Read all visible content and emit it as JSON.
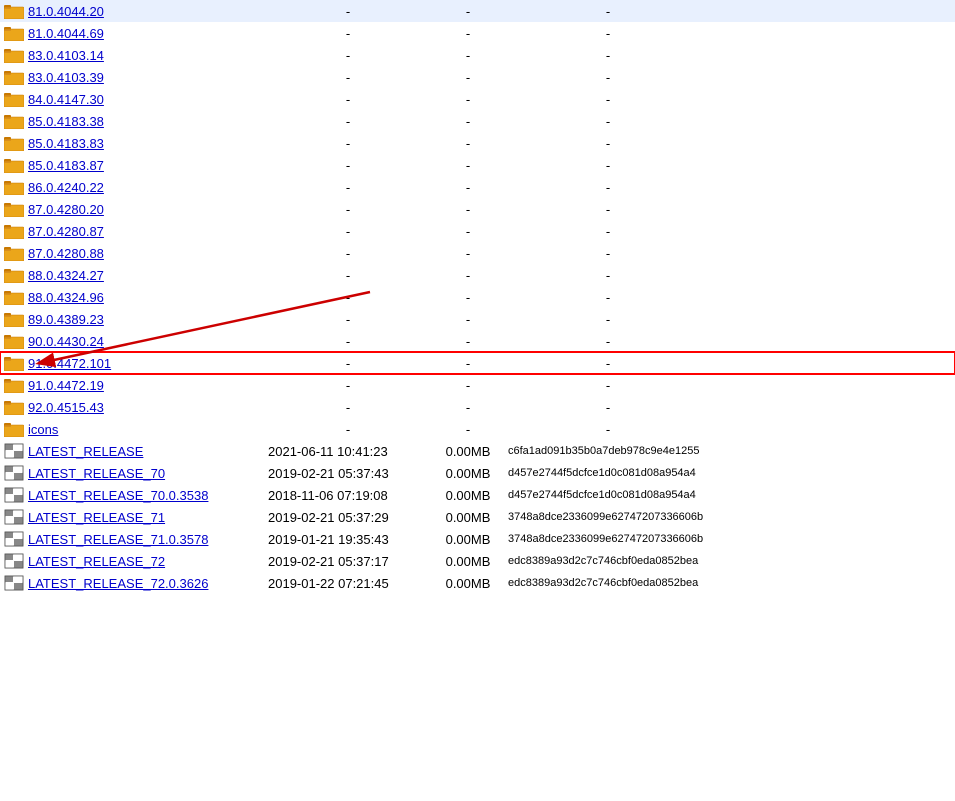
{
  "rows": [
    {
      "type": "folder",
      "name": "81.0.4044.20",
      "date": "",
      "size": "",
      "hash": "",
      "dashes": [
        "-",
        "-",
        "-"
      ]
    },
    {
      "type": "folder",
      "name": "81.0.4044.69",
      "date": "",
      "size": "",
      "hash": "",
      "dashes": [
        "-",
        "-",
        "-"
      ]
    },
    {
      "type": "folder",
      "name": "83.0.4103.14",
      "date": "",
      "size": "",
      "hash": "",
      "dashes": [
        "-",
        "-",
        "-"
      ]
    },
    {
      "type": "folder",
      "name": "83.0.4103.39",
      "date": "",
      "size": "",
      "hash": "",
      "dashes": [
        "-",
        "-",
        "-"
      ]
    },
    {
      "type": "folder",
      "name": "84.0.4147.30",
      "date": "",
      "size": "",
      "hash": "",
      "dashes": [
        "-",
        "-",
        "-"
      ]
    },
    {
      "type": "folder",
      "name": "85.0.4183.38",
      "date": "",
      "size": "",
      "hash": "",
      "dashes": [
        "-",
        "-",
        "-"
      ]
    },
    {
      "type": "folder",
      "name": "85.0.4183.83",
      "date": "",
      "size": "",
      "hash": "",
      "dashes": [
        "-",
        "-",
        "-"
      ]
    },
    {
      "type": "folder",
      "name": "85.0.4183.87",
      "date": "",
      "size": "",
      "hash": "",
      "dashes": [
        "-",
        "-",
        "-"
      ]
    },
    {
      "type": "folder",
      "name": "86.0.4240.22",
      "date": "",
      "size": "",
      "hash": "",
      "dashes": [
        "-",
        "-",
        "-"
      ]
    },
    {
      "type": "folder",
      "name": "87.0.4280.20",
      "date": "",
      "size": "",
      "hash": "",
      "dashes": [
        "-",
        "-",
        "-"
      ]
    },
    {
      "type": "folder",
      "name": "87.0.4280.87",
      "date": "",
      "size": "",
      "hash": "",
      "dashes": [
        "-",
        "-",
        "-"
      ]
    },
    {
      "type": "folder",
      "name": "87.0.4280.88",
      "date": "",
      "size": "",
      "hash": "",
      "dashes": [
        "-",
        "-",
        "-"
      ]
    },
    {
      "type": "folder",
      "name": "88.0.4324.27",
      "date": "",
      "size": "",
      "hash": "",
      "dashes": [
        "-",
        "-",
        "-"
      ]
    },
    {
      "type": "folder",
      "name": "88.0.4324.96",
      "date": "",
      "size": "",
      "hash": "",
      "dashes": [
        "-",
        "-",
        "-"
      ]
    },
    {
      "type": "folder",
      "name": "89.0.4389.23",
      "date": "",
      "size": "",
      "hash": "",
      "dashes": [
        "-",
        "-",
        "-"
      ]
    },
    {
      "type": "folder",
      "name": "90.0.4430.24",
      "date": "",
      "size": "",
      "hash": "",
      "dashes": [
        "-",
        "-",
        "-"
      ]
    },
    {
      "type": "folder",
      "name": "91.0.4472.101",
      "date": "",
      "size": "",
      "hash": "",
      "dashes": [
        "-",
        "-",
        "-"
      ],
      "highlighted": true
    },
    {
      "type": "folder",
      "name": "91.0.4472.19",
      "date": "",
      "size": "",
      "hash": "",
      "dashes": [
        "-",
        "-",
        "-"
      ]
    },
    {
      "type": "folder",
      "name": "92.0.4515.43",
      "date": "",
      "size": "",
      "hash": "",
      "dashes": [
        "-",
        "-",
        "-"
      ]
    },
    {
      "type": "folder",
      "name": "icons",
      "date": "",
      "size": "",
      "hash": "",
      "dashes": [
        "-",
        "-",
        "-"
      ]
    },
    {
      "type": "file",
      "name": "LATEST_RELEASE",
      "date": "2021-06-11 10:41:23",
      "size": "0.00MB",
      "hash": "c6fa1ad091b35b0a7deb978c9e4e1255",
      "dashes": []
    },
    {
      "type": "file",
      "name": "LATEST_RELEASE_70",
      "date": "2019-02-21 05:37:43",
      "size": "0.00MB",
      "hash": "d457e2744f5dcfce1d0c081d08a954a4",
      "dashes": []
    },
    {
      "type": "file",
      "name": "LATEST_RELEASE_70.0.3538",
      "date": "2018-11-06 07:19:08",
      "size": "0.00MB",
      "hash": "d457e2744f5dcfce1d0c081d08a954a4",
      "dashes": []
    },
    {
      "type": "file",
      "name": "LATEST_RELEASE_71",
      "date": "2019-02-21 05:37:29",
      "size": "0.00MB",
      "hash": "3748a8dce2336099e62747207336606b",
      "dashes": []
    },
    {
      "type": "file",
      "name": "LATEST_RELEASE_71.0.3578",
      "date": "2019-01-21 19:35:43",
      "size": "0.00MB",
      "hash": "3748a8dce2336099e62747207336606b",
      "dashes": []
    },
    {
      "type": "file",
      "name": "LATEST_RELEASE_72",
      "date": "2019-02-21 05:37:17",
      "size": "0.00MB",
      "hash": "edc8389a93d2c7c746cbf0eda0852bea",
      "dashes": []
    },
    {
      "type": "file",
      "name": "LATEST_RELEASE_72.0.3626",
      "date": "2019-01-22 07:21:45",
      "size": "0.00MB",
      "hash": "edc8389a93d2c7c746cbf0eda0852bea",
      "dashes": []
    }
  ],
  "colors": {
    "folder_body": "#e8a000",
    "folder_tab": "#c87800",
    "link_color": "#0000cc",
    "highlight_red": "#cc0000"
  }
}
